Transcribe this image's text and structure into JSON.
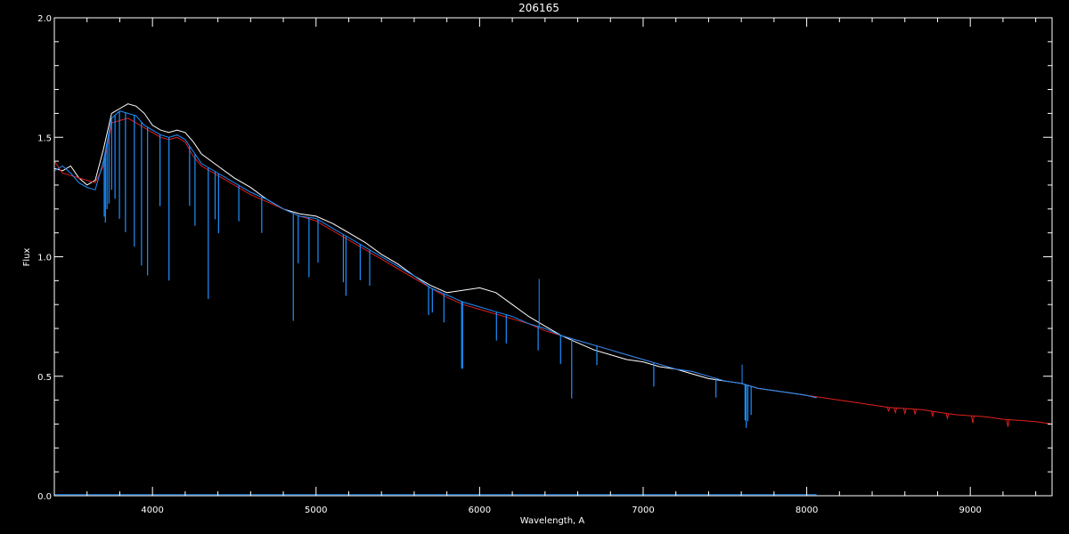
{
  "chart_data": {
    "type": "line",
    "title": "206165",
    "xlabel": "Wavelength, A",
    "ylabel": "Flux",
    "xlim": [
      3400,
      9500
    ],
    "ylim": [
      0.0,
      2.0
    ],
    "x_ticks": [
      4000,
      5000,
      6000,
      7000,
      8000,
      9000
    ],
    "x_tick_labels": [
      "4000",
      "5000",
      "6000",
      "7000",
      "8000",
      "9000"
    ],
    "y_ticks": [
      0.0,
      0.5,
      1.0,
      1.5,
      2.0
    ],
    "y_tick_labels": [
      "0.0",
      "0.5",
      "1.0",
      "1.5",
      "2.0"
    ],
    "x_minor_step": 200,
    "y_minor_step": 0.1,
    "grid": false,
    "legend": "none",
    "colors": {
      "background": "#000000",
      "axes": "#ffffff",
      "observed": "#ffffff",
      "model": "#e0201c",
      "fit": "#1e90ff"
    },
    "series": [
      {
        "key": "observed",
        "color": "#ffffff",
        "x": [
          3400,
          3450,
          3500,
          3550,
          3600,
          3650,
          3700,
          3750,
          3800,
          3850,
          3900,
          3950,
          4000,
          4050,
          4100,
          4150,
          4200,
          4250,
          4300,
          4400,
          4500,
          4600,
          4700,
          4800,
          4900,
          5000,
          5100,
          5200,
          5300,
          5400,
          5500,
          5600,
          5700,
          5800,
          5900,
          6000,
          6100,
          6200,
          6300,
          6400,
          6500,
          6600,
          6700,
          6800,
          6900,
          7000,
          7100,
          7200,
          7300,
          7400,
          7500,
          7600,
          7700,
          7800,
          7900,
          8000,
          8060
        ],
        "y": [
          1.37,
          1.36,
          1.38,
          1.33,
          1.3,
          1.32,
          1.45,
          1.6,
          1.62,
          1.64,
          1.63,
          1.6,
          1.55,
          1.53,
          1.52,
          1.53,
          1.52,
          1.48,
          1.43,
          1.38,
          1.33,
          1.29,
          1.24,
          1.2,
          1.18,
          1.17,
          1.14,
          1.1,
          1.06,
          1.01,
          0.97,
          0.92,
          0.88,
          0.85,
          0.86,
          0.87,
          0.85,
          0.8,
          0.75,
          0.71,
          0.67,
          0.64,
          0.61,
          0.59,
          0.57,
          0.56,
          0.54,
          0.53,
          0.51,
          0.49,
          0.48,
          0.47,
          0.45,
          0.44,
          0.43,
          0.42,
          0.41
        ]
      },
      {
        "key": "model",
        "color": "#e0201c",
        "x": [
          3400,
          3450,
          3500,
          3550,
          3600,
          3650,
          3700,
          3750,
          3800,
          3850,
          3900,
          3950,
          4000,
          4050,
          4100,
          4150,
          4200,
          4250,
          4300,
          4400,
          4500,
          4600,
          4700,
          4800,
          4900,
          5000,
          5100,
          5200,
          5300,
          5400,
          5500,
          5600,
          5700,
          5800,
          5900,
          6000,
          6100,
          6200,
          6300,
          6400,
          6500,
          6600,
          6700,
          6800,
          6900,
          7000,
          7100,
          7200,
          7300,
          7400,
          7500,
          7600,
          7700,
          7800,
          7900,
          8000,
          8100,
          8200,
          8300,
          8400,
          8500,
          8600,
          8700,
          8800,
          8900,
          9000,
          9100,
          9200,
          9300,
          9400,
          9500
        ],
        "y": [
          1.4,
          1.35,
          1.34,
          1.33,
          1.32,
          1.31,
          1.38,
          1.56,
          1.57,
          1.58,
          1.56,
          1.54,
          1.52,
          1.5,
          1.49,
          1.5,
          1.48,
          1.42,
          1.38,
          1.34,
          1.3,
          1.26,
          1.23,
          1.2,
          1.17,
          1.15,
          1.11,
          1.07,
          1.03,
          0.99,
          0.95,
          0.91,
          0.87,
          0.83,
          0.8,
          0.78,
          0.76,
          0.74,
          0.72,
          0.69,
          0.67,
          0.65,
          0.63,
          0.61,
          0.59,
          0.57,
          0.55,
          0.53,
          0.52,
          0.5,
          0.48,
          0.47,
          0.45,
          0.44,
          0.43,
          0.42,
          0.41,
          0.4,
          0.39,
          0.38,
          0.37,
          0.365,
          0.36,
          0.35,
          0.34,
          0.335,
          0.33,
          0.32,
          0.315,
          0.31,
          0.3
        ]
      },
      {
        "key": "fit",
        "color": "#1e90ff",
        "x": [
          3400,
          3450,
          3500,
          3550,
          3600,
          3650,
          3700,
          3750,
          3800,
          3850,
          3900,
          3950,
          4000,
          4050,
          4100,
          4150,
          4200,
          4250,
          4300,
          4400,
          4500,
          4600,
          4700,
          4800,
          4900,
          5000,
          5100,
          5200,
          5300,
          5400,
          5500,
          5600,
          5700,
          5800,
          5900,
          6000,
          6100,
          6200,
          6300,
          6400,
          6500,
          6600,
          6700,
          6800,
          6900,
          7000,
          7100,
          7200,
          7300,
          7400,
          7500,
          7600,
          7700,
          7800,
          7900,
          8000,
          8060
        ],
        "y": [
          1.36,
          1.38,
          1.35,
          1.31,
          1.29,
          1.28,
          1.4,
          1.58,
          1.61,
          1.6,
          1.59,
          1.55,
          1.53,
          1.51,
          1.5,
          1.51,
          1.49,
          1.44,
          1.39,
          1.35,
          1.31,
          1.27,
          1.24,
          1.2,
          1.17,
          1.16,
          1.12,
          1.08,
          1.04,
          1.0,
          0.96,
          0.92,
          0.87,
          0.84,
          0.81,
          0.79,
          0.77,
          0.75,
          0.72,
          0.7,
          0.67,
          0.65,
          0.63,
          0.61,
          0.59,
          0.57,
          0.55,
          0.53,
          0.52,
          0.5,
          0.48,
          0.47,
          0.45,
          0.44,
          0.43,
          0.42,
          0.41
        ]
      },
      {
        "key": "fit-baseline",
        "color": "#1e90ff",
        "x": [
          3400,
          8060
        ],
        "y": [
          0.005,
          0.005
        ]
      }
    ],
    "absorption_lines": {
      "color": "#1e90ff",
      "wavelength": [
        3705,
        3712,
        3722,
        3734,
        3750,
        3771,
        3798,
        3835,
        3889,
        3933,
        3970,
        4046,
        4101,
        4227,
        4260,
        4341,
        4383,
        4404,
        4528,
        4668,
        4861,
        4891,
        4957,
        5012,
        5167,
        5183,
        5270,
        5328,
        5688,
        5711,
        5782,
        5890,
        5896,
        6103,
        6163,
        6358,
        6495,
        6563,
        6717,
        7065,
        7445,
        7623,
        7630,
        7640,
        7660
      ],
      "depth": [
        0.25,
        0.3,
        0.28,
        0.3,
        0.3,
        0.35,
        0.45,
        0.5,
        0.55,
        0.6,
        0.62,
        0.3,
        0.6,
        0.25,
        0.3,
        0.55,
        0.2,
        0.25,
        0.15,
        0.15,
        0.45,
        0.2,
        0.25,
        0.18,
        0.2,
        0.25,
        0.15,
        0.15,
        0.12,
        0.1,
        0.12,
        0.28,
        0.28,
        0.12,
        0.12,
        0.1,
        0.12,
        0.25,
        0.08,
        0.1,
        0.08,
        0.15,
        0.18,
        0.15,
        0.12
      ]
    },
    "emission_lines": {
      "color": "#1e90ff",
      "wavelength": [
        6364,
        7605
      ],
      "height": [
        0.2,
        0.08
      ]
    },
    "model_bumps": {
      "wavelength": [
        8500,
        8542,
        8600,
        8662,
        8770,
        8860,
        9015,
        9230
      ],
      "depth": [
        0.015,
        0.02,
        0.02,
        0.02,
        0.02,
        0.02,
        0.03,
        0.03
      ]
    }
  }
}
